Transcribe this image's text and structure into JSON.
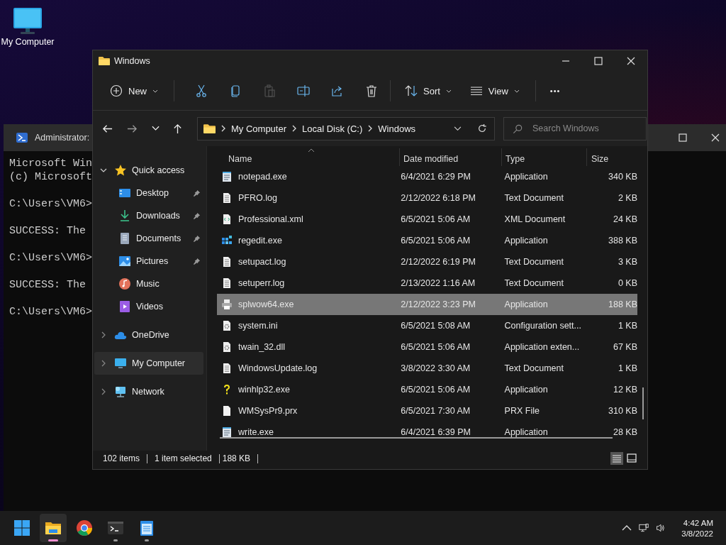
{
  "desktop_icons": [
    {
      "label": "My Computer"
    }
  ],
  "terminal": {
    "title": "Administrator:",
    "lines": [
      "Microsoft Win",
      "(c) Microsoft",
      "C:\\Users\\VM6>",
      "SUCCESS: The",
      "C:\\Users\\VM6>",
      "SUCCESS: The",
      "C:\\Users\\VM6>"
    ]
  },
  "explorer": {
    "title": "Windows",
    "toolbar": {
      "new_label": "New",
      "sort_label": "Sort",
      "view_label": "View",
      "more": "•••",
      "paste_disabled": true
    },
    "address": {
      "crumbs": [
        "My Computer",
        "Local Disk (C:)",
        "Windows"
      ]
    },
    "search": {
      "placeholder": "Search Windows"
    },
    "nav": [
      {
        "label": "Quick access",
        "kind": "star",
        "expanded": true,
        "selected": false,
        "children": [
          {
            "label": "Desktop",
            "kind": "desktop",
            "pinned": true
          },
          {
            "label": "Downloads",
            "kind": "download",
            "pinned": true
          },
          {
            "label": "Documents",
            "kind": "documents",
            "pinned": true
          },
          {
            "label": "Pictures",
            "kind": "pictures",
            "pinned": true
          },
          {
            "label": "Music",
            "kind": "music",
            "pinned": false
          },
          {
            "label": "Videos",
            "kind": "videos",
            "pinned": false
          }
        ]
      },
      {
        "label": "OneDrive",
        "kind": "cloud",
        "expanded": false,
        "selected": false
      },
      {
        "label": "My Computer",
        "kind": "computer",
        "expanded": false,
        "selected": true
      },
      {
        "label": "Network",
        "kind": "network",
        "expanded": false,
        "selected": false
      }
    ],
    "columns": [
      "Name",
      "Date modified",
      "Type",
      "Size"
    ],
    "rows": [
      {
        "name": "notepad.exe",
        "date": "6/4/2021 6:29 PM",
        "type": "Application",
        "size": "340 KB",
        "kind": "notepad",
        "selected": false
      },
      {
        "name": "PFRO.log",
        "date": "2/12/2022 6:18 PM",
        "type": "Text Document",
        "size": "2 KB",
        "kind": "text",
        "selected": false
      },
      {
        "name": "Professional.xml",
        "date": "6/5/2021 5:06 AM",
        "type": "XML Document",
        "size": "24 KB",
        "kind": "xml",
        "selected": false
      },
      {
        "name": "regedit.exe",
        "date": "6/5/2021 5:06 AM",
        "type": "Application",
        "size": "388 KB",
        "kind": "regedit",
        "selected": false
      },
      {
        "name": "setupact.log",
        "date": "2/12/2022 6:19 PM",
        "type": "Text Document",
        "size": "3 KB",
        "kind": "text",
        "selected": false
      },
      {
        "name": "setuperr.log",
        "date": "2/13/2022 1:16 AM",
        "type": "Text Document",
        "size": "0 KB",
        "kind": "text",
        "selected": false
      },
      {
        "name": "splwow64.exe",
        "date": "2/12/2022 3:23 PM",
        "type": "Application",
        "size": "188 KB",
        "kind": "printer",
        "selected": true
      },
      {
        "name": "system.ini",
        "date": "6/5/2021 5:08 AM",
        "type": "Configuration sett...",
        "size": "1 KB",
        "kind": "settings",
        "selected": false
      },
      {
        "name": "twain_32.dll",
        "date": "6/5/2021 5:06 AM",
        "type": "Application exten...",
        "size": "67 KB",
        "kind": "settings",
        "selected": false
      },
      {
        "name": "WindowsUpdate.log",
        "date": "3/8/2022 3:30 AM",
        "type": "Text Document",
        "size": "1 KB",
        "kind": "text",
        "selected": false
      },
      {
        "name": "winhlp32.exe",
        "date": "6/5/2021 5:06 AM",
        "type": "Application",
        "size": "12 KB",
        "kind": "help",
        "selected": false
      },
      {
        "name": "WMSysPr9.prx",
        "date": "6/5/2021 7:30 AM",
        "type": "PRX File",
        "size": "310 KB",
        "kind": "blank",
        "selected": false
      },
      {
        "name": "write.exe",
        "date": "6/4/2021 6:39 PM",
        "type": "Application",
        "size": "28 KB",
        "kind": "notepad",
        "selected": false
      }
    ],
    "status": {
      "count": "102 items",
      "selection": "1 item selected",
      "size": "188 KB"
    },
    "views": [
      {
        "kind": "details",
        "selected": true
      },
      {
        "kind": "tiles",
        "selected": false
      }
    ]
  },
  "taskbar": {
    "apps": [
      {
        "kind": "start",
        "active": false,
        "running": false
      },
      {
        "kind": "explorer",
        "active": true,
        "running": true
      },
      {
        "kind": "chrome",
        "active": false,
        "running": false
      },
      {
        "kind": "terminal",
        "active": false,
        "running": true
      },
      {
        "kind": "notepad",
        "active": false,
        "running": true
      }
    ],
    "time": "4:42 AM",
    "date": "3/8/2022"
  }
}
